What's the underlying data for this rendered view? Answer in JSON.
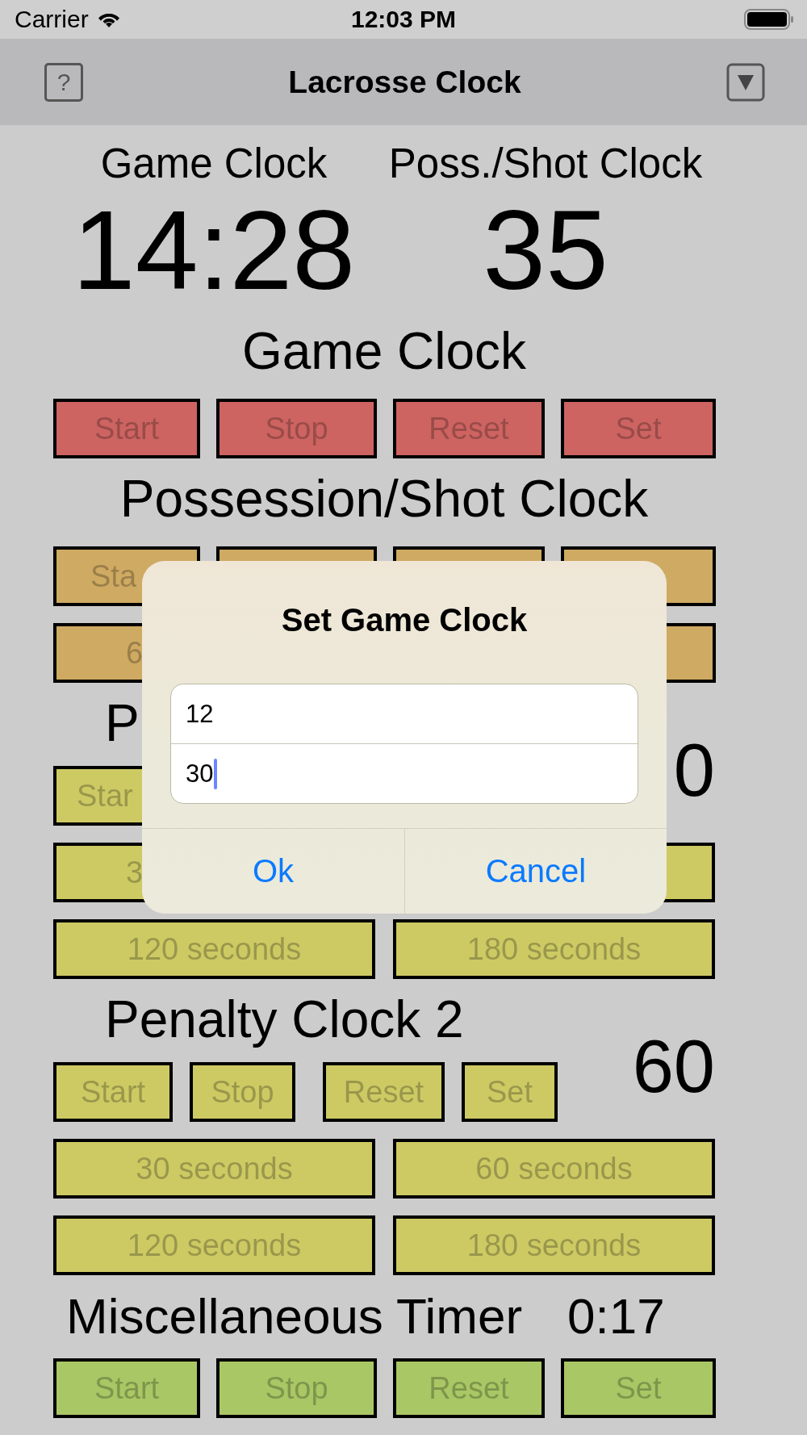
{
  "status_bar": {
    "carrier": "Carrier",
    "time": "12:03 PM"
  },
  "nav_bar": {
    "help_button": "?",
    "title": "Lacrosse Clock"
  },
  "clocks": [
    {
      "label": "Game Clock",
      "value": "14:28"
    },
    {
      "label": "Poss./Shot Clock",
      "value": "35"
    }
  ],
  "sections": [
    {
      "kind": "centered",
      "title": "Game Clock",
      "color": "#cd6461",
      "rows": [
        {
          "kind": "four",
          "labels": [
            "Start",
            "Stop",
            "Reset",
            "Set"
          ]
        }
      ]
    },
    {
      "kind": "centered",
      "title": "Possession/Shot Clock",
      "color": "#cfaa62",
      "rows": [
        {
          "kind": "four",
          "labels": [
            "Sta"
          ]
        },
        {
          "kind": "four",
          "labels": [
            "6"
          ]
        }
      ]
    },
    {
      "kind": "penalty",
      "title": "P",
      "value": "0",
      "color": "#cdca64",
      "rows": [
        {
          "kind": "short",
          "labels": [
            "Star"
          ]
        },
        {
          "kind": "two",
          "labels": [
            "3"
          ]
        },
        {
          "kind": "two",
          "labels": [
            "120 seconds",
            "180 seconds"
          ]
        }
      ]
    },
    {
      "kind": "penalty",
      "title": "Penalty Clock 2",
      "value": "60",
      "color": "#cdca64",
      "rows": [
        {
          "kind": "short",
          "labels": [
            "Start",
            "Stop",
            "Reset",
            "Set"
          ]
        },
        {
          "kind": "two",
          "labels": [
            "30 seconds",
            "60 seconds"
          ]
        },
        {
          "kind": "two",
          "labels": [
            "120 seconds",
            "180 seconds"
          ]
        }
      ]
    },
    {
      "kind": "timer",
      "title": "Miscellaneous Timer",
      "value": "0:17",
      "color": "#a9c765",
      "rows": [
        {
          "kind": "four",
          "labels": [
            "Start",
            "Stop",
            "Reset",
            "Set"
          ]
        }
      ]
    }
  ],
  "dialog": {
    "title": "Set Game Clock",
    "fields": [
      {
        "value": "12",
        "focused": false
      },
      {
        "value": "30",
        "focused": true
      }
    ],
    "buttons": [
      "Ok",
      "Cancel"
    ]
  }
}
